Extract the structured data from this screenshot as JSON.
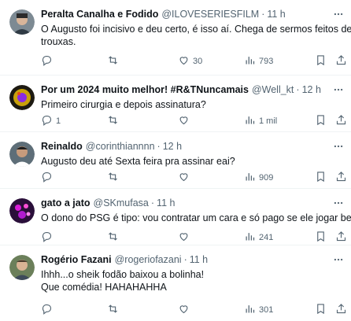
{
  "tweets": [
    {
      "name": "Peralta Canalha e Fodido",
      "handle": "@ILOVESERIESFILM",
      "time": "11 h",
      "text": [
        "O Augusto foi incisivo e deu certo, é isso aí. Chega de sermos feitos de",
        "trouxas."
      ],
      "replies": "",
      "retweets": "",
      "likes": "30",
      "views": "793"
    },
    {
      "name": "Por um 2024 muito melhor! #R&TNuncamais",
      "handle": "@Well_kt",
      "time": "12 h",
      "text": [
        "Primeiro cirurgia e depois assinatura?"
      ],
      "replies": "1",
      "retweets": "",
      "likes": "",
      "views": "1 mil"
    },
    {
      "name": "Reinaldo",
      "handle": "@corinthiannnn",
      "time": "12 h",
      "text": [
        "Augusto deu até Sexta feira pra assinar eai?"
      ],
      "replies": "",
      "retweets": "",
      "likes": "",
      "views": "909"
    },
    {
      "name": "gato a jato",
      "handle": "@SKmufasa",
      "time": "11 h",
      "text": [
        "O dono do PSG é tipo: vou contratar um cara e só pago se ele jogar bem"
      ],
      "replies": "",
      "retweets": "",
      "likes": "",
      "views": "241"
    },
    {
      "name": "Rogério Fazani",
      "handle": "@rogeriofazani",
      "time": "11 h",
      "text": [
        "Ihhh...o sheik fodão baixou a bolinha!",
        "Que comédia! HAHAHAHHA"
      ],
      "replies": "",
      "retweets": "",
      "likes": "",
      "views": "301"
    }
  ],
  "colors": {
    "text": "#0f1419",
    "secondary": "#536471",
    "divider": "#eff3f4"
  },
  "icons": [
    "more-icon",
    "reply-icon",
    "retweet-icon",
    "like-icon",
    "views-icon",
    "bookmark-icon",
    "share-icon"
  ]
}
